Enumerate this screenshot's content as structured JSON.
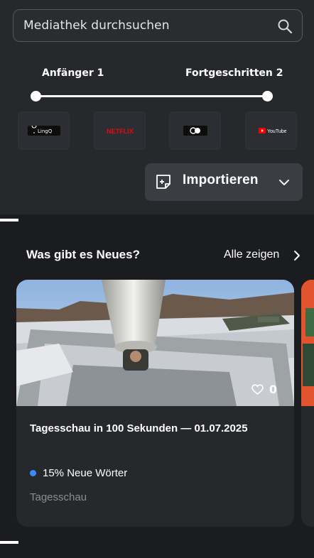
{
  "search": {
    "placeholder": "Mediathek durchsuchen",
    "icon": "search-icon"
  },
  "level_slider": {
    "min_label": "Anfänger 1",
    "max_label": "Fortgeschritten 2"
  },
  "sources": [
    {
      "name": "LingQ",
      "icon": "lingq-logo"
    },
    {
      "name": "NETFLIX",
      "icon": "netflix-logo"
    },
    {
      "name": "podcast",
      "icon": "podcast-logo"
    },
    {
      "name": "YouTube",
      "icon": "youtube-logo"
    }
  ],
  "import_button": {
    "label": "Importieren"
  },
  "news_section": {
    "title": "Was gibt es Neues?",
    "see_all": "Alle zeigen",
    "cards": [
      {
        "title": "Tagesschau in 100 Sekunden — 01.07.2025",
        "likes": "0",
        "new_words": "15% Neue Wörter",
        "channel": "Tagesschau"
      }
    ]
  },
  "colors": {
    "background": "#1b1c1f",
    "panel": "#26282c",
    "accent_dot": "#3a8bff",
    "muted_text": "#8a8d93"
  }
}
